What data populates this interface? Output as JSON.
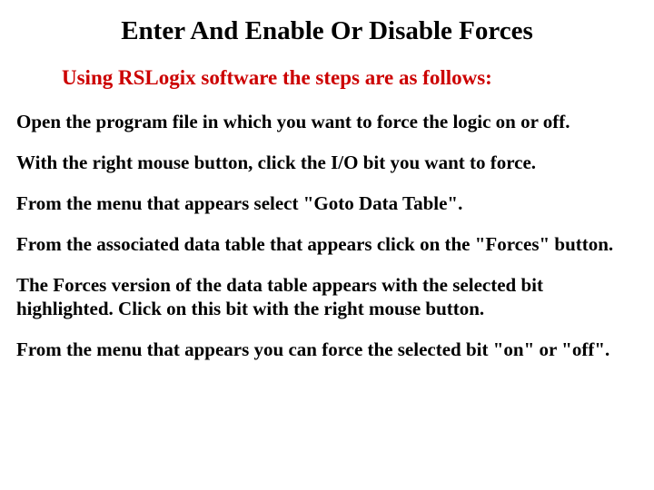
{
  "title": "Enter And Enable Or Disable Forces",
  "subtitle": "Using RSLogix software the steps are as follows:",
  "steps": [
    "Open the program file in which you want to force the logic on or off.",
    "With the right mouse button, click the I/O bit you want to force.",
    "From the menu that appears select \"Goto Data Table\".",
    "From the associated data table that appears click on the \"Forces\" button.",
    "The Forces version of the data table appears with the selected bit highlighted. Click on this bit with the right mouse button.",
    "From the menu that appears you can force the selected bit \"on\" or \"off\"."
  ]
}
